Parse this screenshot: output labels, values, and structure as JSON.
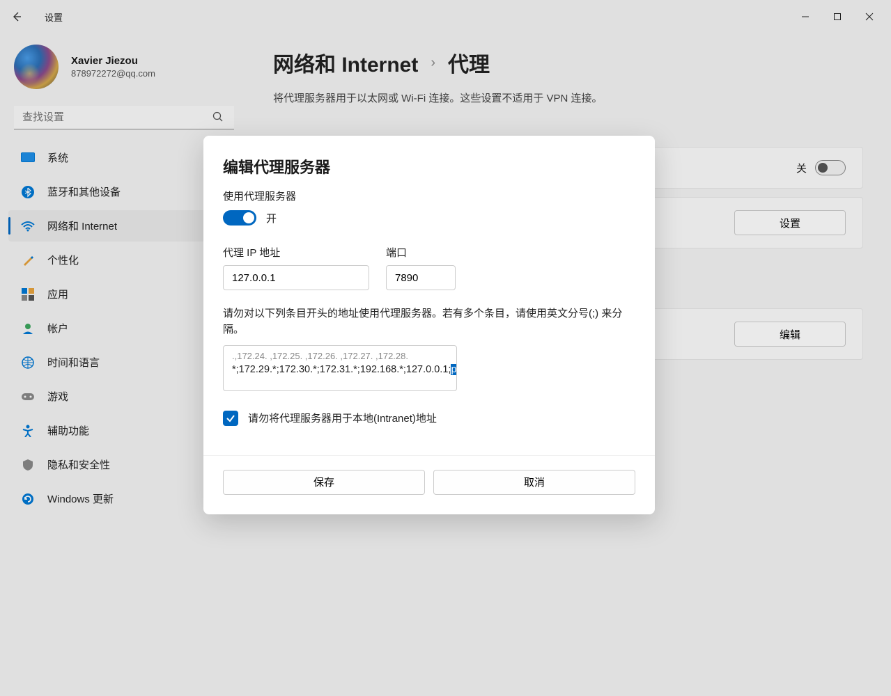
{
  "app": {
    "title": "设置"
  },
  "user": {
    "name": "Xavier Jiezou",
    "email": "878972272@qq.com"
  },
  "search": {
    "placeholder": "查找设置"
  },
  "nav": [
    {
      "label": "系统"
    },
    {
      "label": "蓝牙和其他设备"
    },
    {
      "label": "网络和 Internet"
    },
    {
      "label": "个性化"
    },
    {
      "label": "应用"
    },
    {
      "label": "帐户"
    },
    {
      "label": "时间和语言"
    },
    {
      "label": "游戏"
    },
    {
      "label": "辅助功能"
    },
    {
      "label": "隐私和安全性"
    },
    {
      "label": "Windows 更新"
    }
  ],
  "breadcrumb": {
    "parent": "网络和 Internet",
    "current": "代理"
  },
  "subtitle": "将代理服务器用于以太网或 Wi-Fi 连接。这些设置不适用于 VPN 连接。",
  "auto_toggle": {
    "label": "关"
  },
  "row_buttons": {
    "settings": "设置",
    "edit": "编辑"
  },
  "modal": {
    "title": "编辑代理服务器",
    "use_proxy_label": "使用代理服务器",
    "toggle_state": "开",
    "ip_label": "代理 IP 地址",
    "ip_value": "127.0.0.1",
    "port_label": "端口",
    "port_value": "7890",
    "exceptions_help": "请勿对以下列条目开头的地址使用代理服务器。若有多个条目，请使用英文分号(;) 来分隔。",
    "exceptions_line1_prefix": "*;172.29.*;172.30.*;172.31.*;192.168.*;127.0.0.1;",
    "exceptions_selected": "pypi.tuna.tsinghua.edu.cn",
    "bypass_local_label": "请勿将代理服务器用于本地(Intranet)地址",
    "save": "保存",
    "cancel": "取消"
  }
}
